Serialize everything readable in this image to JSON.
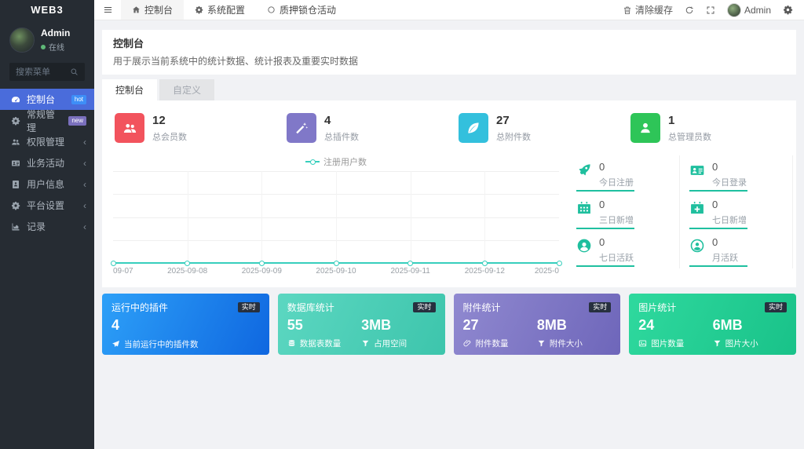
{
  "sidebar": {
    "logo": "WEB3",
    "user": {
      "name": "Admin",
      "status": "在线",
      "status_color": "#5fb878"
    },
    "search": {
      "placeholder": "搜索菜单",
      "icon": "search-icon"
    },
    "items": [
      {
        "label": "控制台",
        "icon": "gauge-icon",
        "badge": "hot",
        "badge_color": "#3e8ef7",
        "active": true
      },
      {
        "label": "常规管理",
        "icon": "cogs-icon",
        "badge": "new",
        "badge_color": "#7a70bd",
        "active": false
      },
      {
        "label": "权限管理",
        "icon": "users-icon",
        "chevron": "‹",
        "active": false
      },
      {
        "label": "业务活动",
        "icon": "id-card-icon",
        "chevron": "‹",
        "active": false
      },
      {
        "label": "用户信息",
        "icon": "address-book-icon",
        "chevron": "‹",
        "active": false
      },
      {
        "label": "平台设置",
        "icon": "gear-icon",
        "chevron": "‹",
        "active": false
      },
      {
        "label": "记录",
        "icon": "chart-area-icon",
        "chevron": "‹",
        "active": false
      }
    ],
    "active_bg": "#4a6cdb",
    "bg": "#262c33"
  },
  "navbar": {
    "tabs": [
      {
        "label": "控制台",
        "icon": "home-icon",
        "active": true
      },
      {
        "label": "系统配置",
        "icon": "gear-icon",
        "active": false
      },
      {
        "label": "质押锁仓活动",
        "icon": "circle-icon",
        "active": false
      }
    ],
    "right": {
      "clear_cache_label": "清除缓存",
      "username": "Admin"
    }
  },
  "page": {
    "title": "控制台",
    "subtitle": "用于展示当前系统中的统计数据、统计报表及重要实时数据",
    "tabs": [
      {
        "label": "控制台",
        "active": true
      },
      {
        "label": "自定义",
        "active": false
      }
    ]
  },
  "stats": [
    {
      "value": "12",
      "label": "总会员数",
      "icon": "users-icon",
      "color": "#f2535d"
    },
    {
      "value": "4",
      "label": "总插件数",
      "icon": "magic-wand-icon",
      "color": "#8078c8"
    },
    {
      "value": "27",
      "label": "总附件数",
      "icon": "leaf-icon",
      "color": "#33c0dd"
    },
    {
      "value": "1",
      "label": "总管理员数",
      "icon": "user-icon",
      "color": "#2ec558"
    }
  ],
  "chart_data": {
    "type": "line",
    "series": [
      {
        "name": "注册用户数",
        "values": [
          0,
          0,
          0,
          0,
          0,
          0,
          0
        ],
        "color": "#38cfbd"
      }
    ],
    "x": [
      "09-07",
      "2025-09-08",
      "2025-09-09",
      "2025-09-10",
      "2025-09-11",
      "2025-09-12",
      "2025-0"
    ],
    "ylim": [
      0,
      1
    ],
    "grid": true,
    "legend_position": "top-center"
  },
  "mini_stats": [
    {
      "value": "0",
      "label": "今日注册",
      "icon": "rocket-icon"
    },
    {
      "value": "0",
      "label": "今日登录",
      "icon": "id-card-icon"
    },
    {
      "value": "0",
      "label": "三日新增",
      "icon": "calendar-icon"
    },
    {
      "value": "0",
      "label": "七日新增",
      "icon": "calendar-plus-icon"
    },
    {
      "value": "0",
      "label": "七日活跃",
      "icon": "user-circle-icon"
    },
    {
      "value": "0",
      "label": "月活跃",
      "icon": "user-circle-outline-icon"
    }
  ],
  "mini_stats_accent": "#1fc0a0",
  "cards": [
    {
      "title": "运行中的插件",
      "badge": "实时",
      "value": "4",
      "footer": "当前运行中的插件数",
      "footer_icon": "paper-plane-icon",
      "colors": [
        "#2da0f8",
        "#0f67e0"
      ]
    },
    {
      "title": "数据库统计",
      "badge": "实时",
      "left": {
        "value": "55",
        "label": "数据表数量",
        "icon": "database-icon"
      },
      "right": {
        "value": "3MB",
        "label": "占用空间",
        "icon": "funnel-icon"
      },
      "colors": [
        "#5cd7c1",
        "#3dc5ac"
      ]
    },
    {
      "title": "附件统计",
      "badge": "实时",
      "left": {
        "value": "27",
        "label": "附件数量",
        "icon": "paperclip-icon"
      },
      "right": {
        "value": "8MB",
        "label": "附件大小",
        "icon": "funnel-icon"
      },
      "colors": [
        "#9089d0",
        "#6e66ba"
      ]
    },
    {
      "title": "图片统计",
      "badge": "实时",
      "left": {
        "value": "24",
        "label": "图片数量",
        "icon": "image-icon"
      },
      "right": {
        "value": "6MB",
        "label": "图片大小",
        "icon": "funnel-icon"
      },
      "colors": [
        "#2fd99e",
        "#19c289"
      ]
    }
  ]
}
